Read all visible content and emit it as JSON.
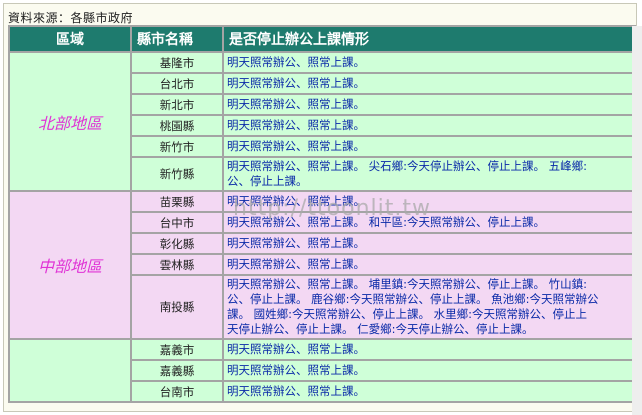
{
  "source_note": "資料來源：各縣市政府",
  "headers": {
    "region": "區域",
    "city": "縣市名稱",
    "status": "是否停止辦公上課情形"
  },
  "watermark": "http://ttoonlit.tw",
  "colors": {
    "header_bg": "#1e7b6e",
    "north_bg": "#cfffd8",
    "central_bg": "#f3d8f3",
    "south_bg": "#cfffd8",
    "region_text": "#e033d6",
    "status_text": "#0a2aa8"
  },
  "rows": [
    {
      "region": "北部地區",
      "cities": [
        {
          "name": "基隆市",
          "status": "明天照常辦公、照常上課。"
        },
        {
          "name": "台北市",
          "status": "明天照常辦公、照常上課。"
        },
        {
          "name": "新北市",
          "status": "明天照常辦公、照常上課。"
        },
        {
          "name": "桃園縣",
          "status": "明天照常辦公、照常上課。"
        },
        {
          "name": "新竹市",
          "status": "明天照常辦公、照常上課。"
        },
        {
          "name": "新竹縣",
          "status": "明天照常辦公、照常上課。 尖石鄉:今天停止辦公、停止上課。 五峰鄉:\n公、停止上課。"
        }
      ]
    },
    {
      "region": "中部地區",
      "cities": [
        {
          "name": "苗栗縣",
          "status": "明天照常辦公、照常上課。"
        },
        {
          "name": "台中市",
          "status": "明天照常辦公、照常上課。 和平區:今天照常辦公、停止上課。"
        },
        {
          "name": "彰化縣",
          "status": "明天照常辦公、照常上課。"
        },
        {
          "name": "雲林縣",
          "status": "明天照常辦公、照常上課。"
        },
        {
          "name": "南投縣",
          "status": "明天照常辦公、照常上課。 埔里鎮:今天照常辦公、停止上課。 竹山鎮:\n公、停止上課。 鹿谷鄉:今天照常辦公、停止上課。 魚池鄉:今天照常辦公\n課。 國姓鄉:今天照常辦公、停止上課。 水里鄉:今天照常辦公、停止上\n天停止辦公、停止上課。 仁愛鄉:今天停止辦公、停止上課。"
        }
      ]
    },
    {
      "region": "",
      "cities": [
        {
          "name": "嘉義市",
          "status": "明天照常辦公、照常上課。"
        },
        {
          "name": "嘉義縣",
          "status": "明天照常辦公、照常上課。"
        },
        {
          "name": "台南市",
          "status": "明天照常辦公、照常上課。"
        }
      ]
    }
  ]
}
